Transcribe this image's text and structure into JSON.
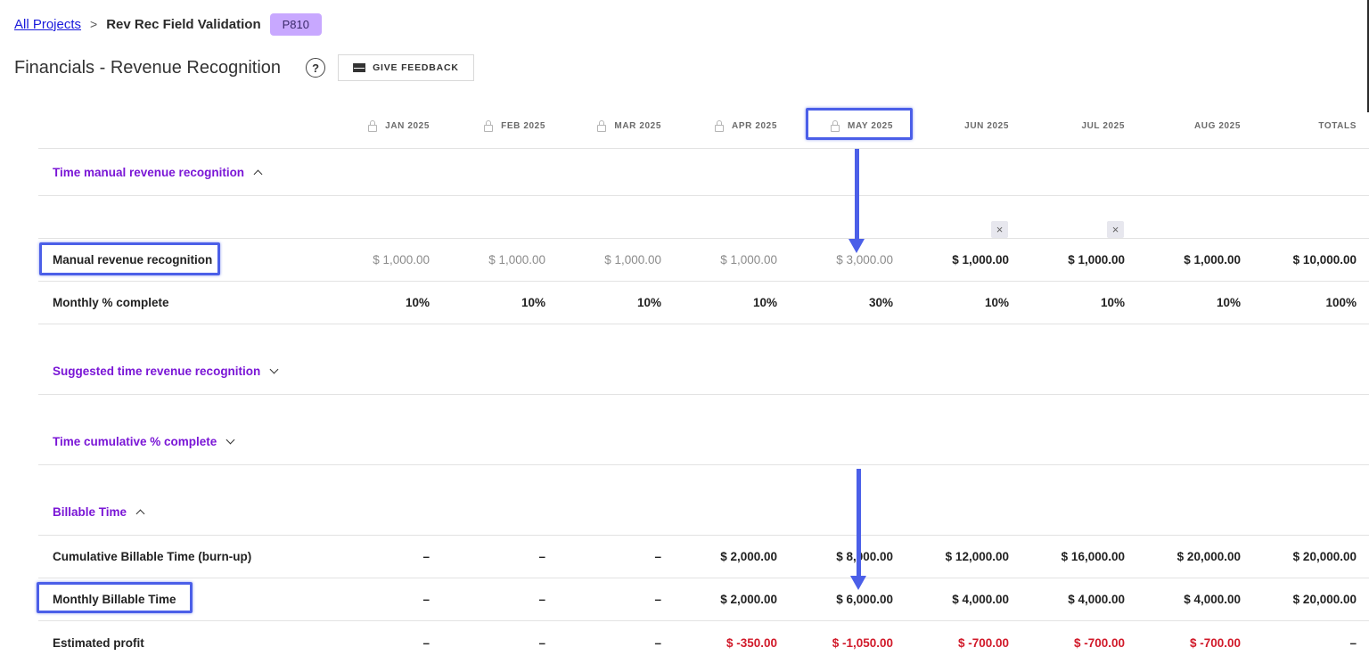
{
  "breadcrumb": {
    "root": "All Projects",
    "separator": ">",
    "current": "Rev Rec Field Validation",
    "badge": "P810"
  },
  "page": {
    "title": "Financials - Revenue Recognition",
    "help": "?",
    "feedback_label": "GIVE FEEDBACK"
  },
  "columns": [
    "JAN 2025",
    "FEB 2025",
    "MAR 2025",
    "APR 2025",
    "MAY 2025",
    "JUN 2025",
    "JUL 2025",
    "AUG 2025",
    "TOTALS"
  ],
  "locked_columns": [
    0,
    1,
    2,
    3,
    4
  ],
  "sections": {
    "time_manual": "Time manual revenue recognition",
    "suggested": "Suggested time revenue recognition",
    "cumulative": "Time cumulative % complete",
    "billable": "Billable Time"
  },
  "rows": {
    "manual": {
      "label": "Manual revenue recognition",
      "values": [
        "$ 1,000.00",
        "$ 1,000.00",
        "$ 1,000.00",
        "$ 1,000.00",
        "$ 3,000.00",
        "$ 1,000.00",
        "$ 1,000.00",
        "$ 1,000.00",
        "$ 10,000.00"
      ]
    },
    "monthly_pct": {
      "label": "Monthly % complete",
      "values": [
        "10%",
        "10%",
        "10%",
        "10%",
        "30%",
        "10%",
        "10%",
        "10%",
        "100%"
      ]
    },
    "cumulative_billable": {
      "label": "Cumulative Billable Time (burn-up)",
      "values": [
        "–",
        "–",
        "–",
        "$ 2,000.00",
        "$ 8,000.00",
        "$ 12,000.00",
        "$ 16,000.00",
        "$ 20,000.00",
        "$ 20,000.00"
      ]
    },
    "monthly_billable": {
      "label": "Monthly Billable Time",
      "values": [
        "–",
        "–",
        "–",
        "$ 2,000.00",
        "$ 6,000.00",
        "$ 4,000.00",
        "$ 4,000.00",
        "$ 4,000.00",
        "$ 20,000.00"
      ]
    },
    "estimated_profit": {
      "label": "Estimated profit",
      "values": [
        "–",
        "–",
        "–",
        "$ -350.00",
        "$ -1,050.00",
        "$ -700.00",
        "$ -700.00",
        "$ -700.00",
        "–"
      ]
    }
  },
  "clear_icon": "×",
  "colors": {
    "accent": "#7a16d6",
    "link": "#1a1adb",
    "badge": "#c8a8ff",
    "negative": "#d11a2a",
    "annotation": "#4b5fe8"
  }
}
